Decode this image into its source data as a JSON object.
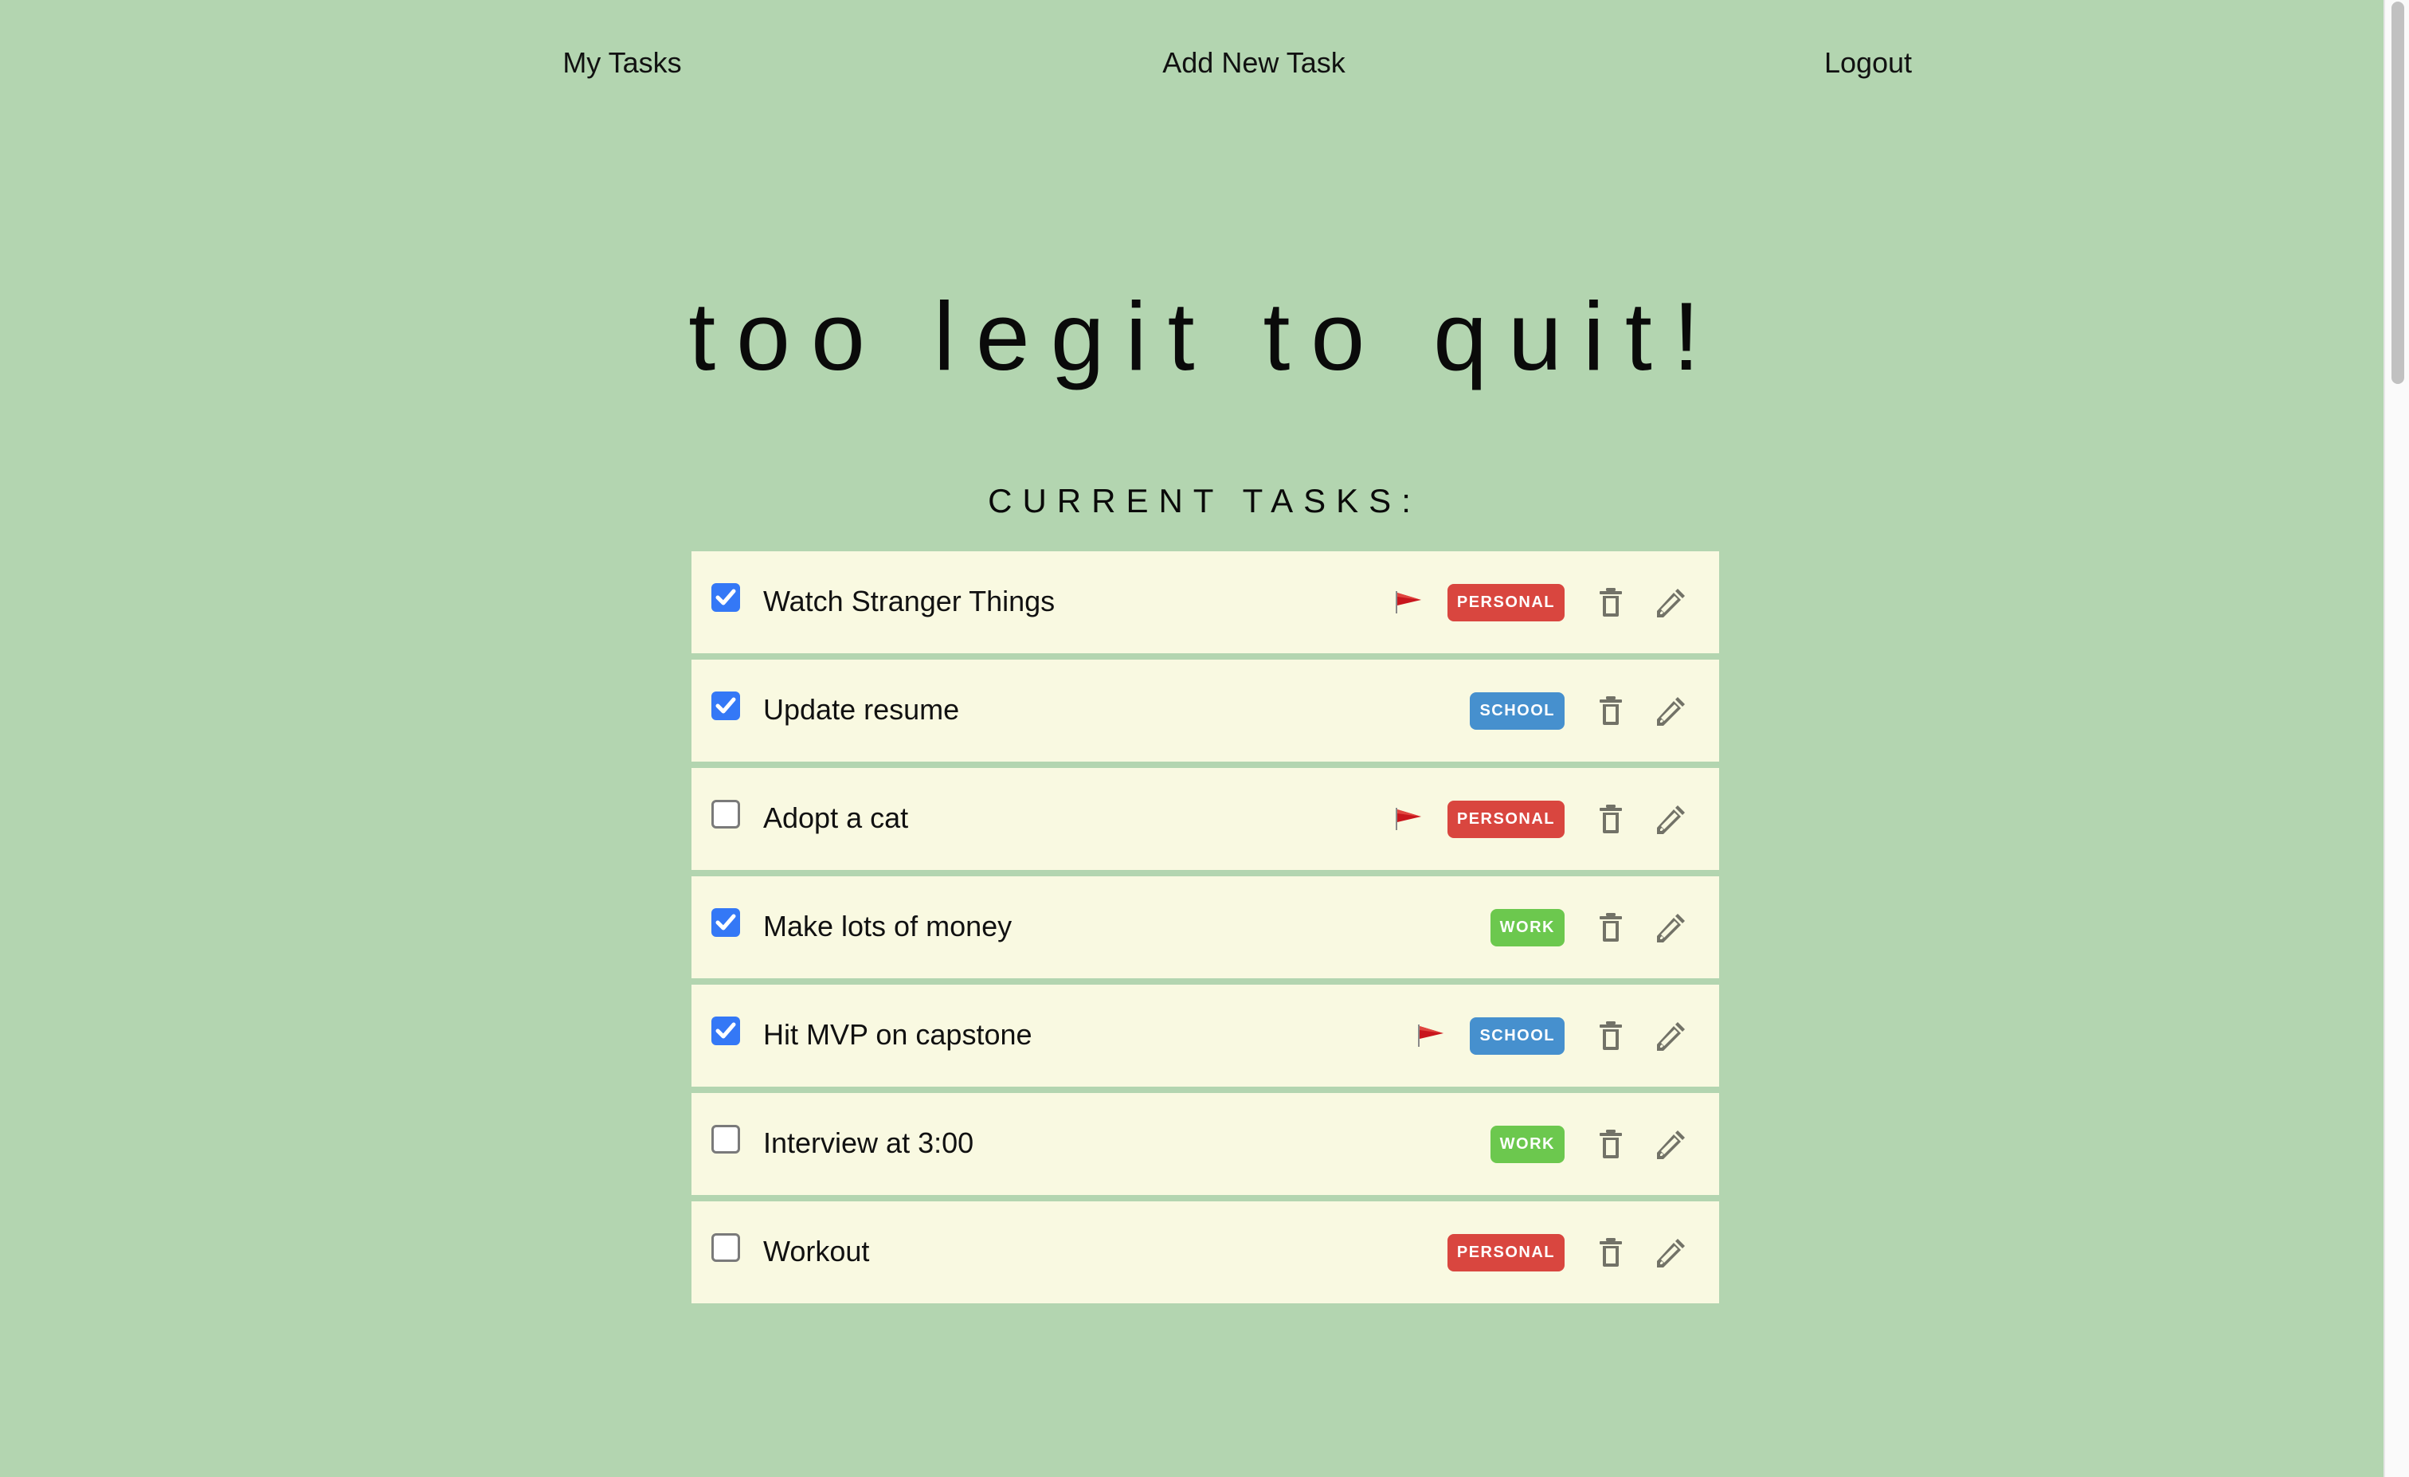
{
  "nav": {
    "my_tasks": "My Tasks",
    "add_new_task": "Add New Task",
    "logout": "Logout"
  },
  "header": {
    "title": "too legit to quit!",
    "subtitle": "CURRENT TASKS:"
  },
  "colors": {
    "background": "#b3d5b0",
    "card": "#f9f9e1",
    "checkbox_checked": "#3478f6",
    "flag": "#c8161d",
    "icon": "#727267",
    "categories": {
      "PERSONAL": "#d9463f",
      "SCHOOL": "#4690ce",
      "WORK": "#6cc84e"
    }
  },
  "tasks": [
    {
      "title": "Watch Stranger Things",
      "completed": true,
      "flagged": true,
      "category": "PERSONAL"
    },
    {
      "title": "Update resume",
      "completed": true,
      "flagged": false,
      "category": "SCHOOL"
    },
    {
      "title": "Adopt a cat",
      "completed": false,
      "flagged": true,
      "category": "PERSONAL"
    },
    {
      "title": "Make lots of money",
      "completed": true,
      "flagged": false,
      "category": "WORK"
    },
    {
      "title": "Hit MVP on capstone",
      "completed": true,
      "flagged": true,
      "category": "SCHOOL"
    },
    {
      "title": "Interview at 3:00",
      "completed": false,
      "flagged": false,
      "category": "WORK"
    },
    {
      "title": "Workout",
      "completed": false,
      "flagged": false,
      "category": "PERSONAL"
    }
  ],
  "icons": {
    "flag": "red-flag-icon",
    "delete": "trash-icon",
    "edit": "pencil-icon",
    "checked": "checkmark-icon"
  }
}
